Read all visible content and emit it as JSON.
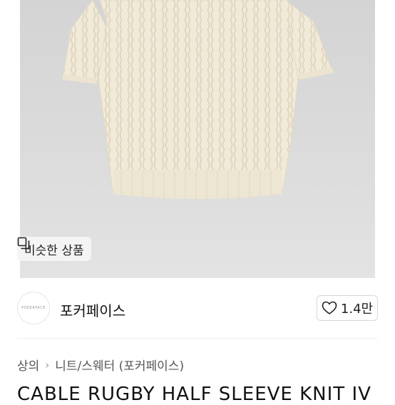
{
  "similar_button": {
    "label": "비슷한 상품",
    "icon": "copy-icon"
  },
  "shop": {
    "avatar_text": "POKERFACE",
    "name": "포커페이스"
  },
  "like": {
    "icon": "heart-icon",
    "count": "1.4만"
  },
  "breadcrumb": {
    "items": [
      "상의",
      "니트/스웨터 (포커페이스)"
    ]
  },
  "product": {
    "title": "CABLE RUGBY HALF SLEEVE KNIT IV"
  }
}
